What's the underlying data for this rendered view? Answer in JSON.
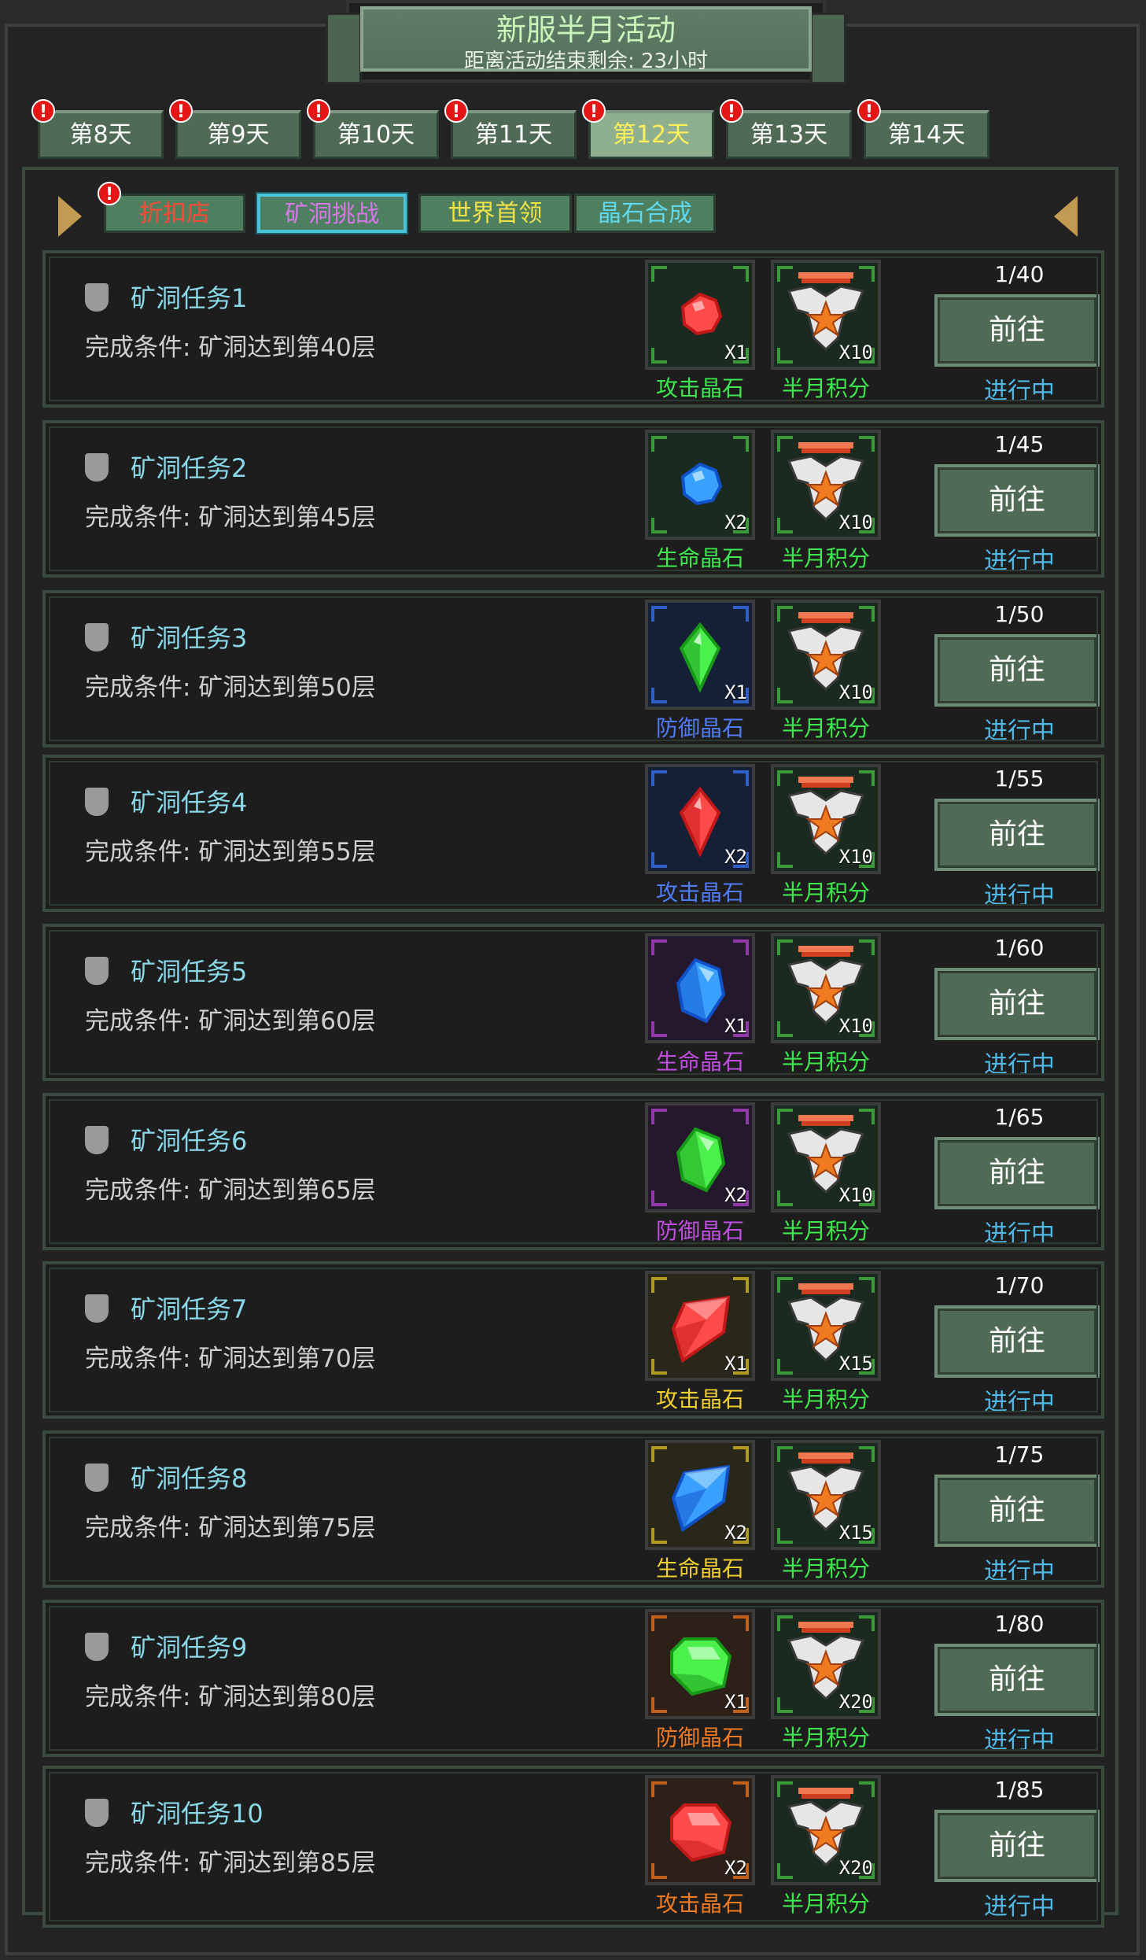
{
  "banner": {
    "title": "新服半月活动",
    "subtitle": "距离活动结束剩余: 23小时"
  },
  "days": [
    {
      "label": "第8天",
      "active": false
    },
    {
      "label": "第9天",
      "active": false
    },
    {
      "label": "第10天",
      "active": false
    },
    {
      "label": "第11天",
      "active": false
    },
    {
      "label": "第12天",
      "active": true
    },
    {
      "label": "第13天",
      "active": false
    },
    {
      "label": "第14天",
      "active": false
    }
  ],
  "badge_symbol": "!",
  "subtabs": [
    {
      "label": "折扣店",
      "color": "#ff4a3a",
      "active": false,
      "badge": true
    },
    {
      "label": "矿洞挑战",
      "color": "#d678e8",
      "active": true,
      "badge": false
    },
    {
      "label": "世界首领",
      "color": "#f2e24a",
      "active": false,
      "badge": false
    },
    {
      "label": "晶石合成",
      "color": "#5fd8ee",
      "active": false,
      "badge": false
    }
  ],
  "go_label": "前往",
  "status_label": "进行中",
  "points_label": "半月积分",
  "tasks": [
    {
      "name": "矿洞任务1",
      "cond": "完成条件: 矿洞达到第40层",
      "gem": "攻击晶石",
      "gem_color": "#3ee84e",
      "gem_qty": "X1",
      "gem_icon": "red-round-gem-icon",
      "pts_qty": "X10",
      "progress": "1/40"
    },
    {
      "name": "矿洞任务2",
      "cond": "完成条件: 矿洞达到第45层",
      "gem": "生命晶石",
      "gem_color": "#3ee84e",
      "gem_qty": "X2",
      "gem_icon": "blue-round-gem-icon",
      "pts_qty": "X10",
      "progress": "1/45"
    },
    {
      "name": "矿洞任务3",
      "cond": "完成条件: 矿洞达到第50层",
      "gem": "防御晶石",
      "gem_color": "#4f7cf5",
      "gem_qty": "X1",
      "gem_icon": "green-crystal-icon",
      "pts_qty": "X10",
      "progress": "1/50"
    },
    {
      "name": "矿洞任务4",
      "cond": "完成条件: 矿洞达到第55层",
      "gem": "攻击晶石",
      "gem_color": "#4f7cf5",
      "gem_qty": "X2",
      "gem_icon": "red-crystal-icon",
      "pts_qty": "X10",
      "progress": "1/55"
    },
    {
      "name": "矿洞任务5",
      "cond": "完成条件: 矿洞达到第60层",
      "gem": "生命晶石",
      "gem_color": "#c04ee0",
      "gem_qty": "X1",
      "gem_icon": "blue-shard-icon",
      "pts_qty": "X10",
      "progress": "1/60"
    },
    {
      "name": "矿洞任务6",
      "cond": "完成条件: 矿洞达到第65层",
      "gem": "防御晶石",
      "gem_color": "#c04ee0",
      "gem_qty": "X2",
      "gem_icon": "green-shard-icon",
      "pts_qty": "X10",
      "progress": "1/65"
    },
    {
      "name": "矿洞任务7",
      "cond": "完成条件: 矿洞达到第70层",
      "gem": "攻击晶石",
      "gem_color": "#f0d030",
      "gem_qty": "X1",
      "gem_icon": "red-large-gem-icon",
      "pts_qty": "X15",
      "progress": "1/70"
    },
    {
      "name": "矿洞任务8",
      "cond": "完成条件: 矿洞达到第75层",
      "gem": "生命晶石",
      "gem_color": "#f0d030",
      "gem_qty": "X2",
      "gem_icon": "blue-large-gem-icon",
      "pts_qty": "X15",
      "progress": "1/75"
    },
    {
      "name": "矿洞任务9",
      "cond": "完成条件: 矿洞达到第80层",
      "gem": "防御晶石",
      "gem_color": "#f07a20",
      "gem_qty": "X1",
      "gem_icon": "green-cut-gem-icon",
      "pts_qty": "X20",
      "progress": "1/80"
    },
    {
      "name": "矿洞任务10",
      "cond": "完成条件: 矿洞达到第85层",
      "gem": "攻击晶石",
      "gem_color": "#f07a20",
      "gem_qty": "X2",
      "gem_icon": "red-cut-gem-icon",
      "pts_qty": "X20",
      "progress": "1/85"
    }
  ],
  "colors": {
    "points_label": "#3ee84e",
    "frame_green": "#4f6b56",
    "status_blue": "#4fb9e6"
  }
}
